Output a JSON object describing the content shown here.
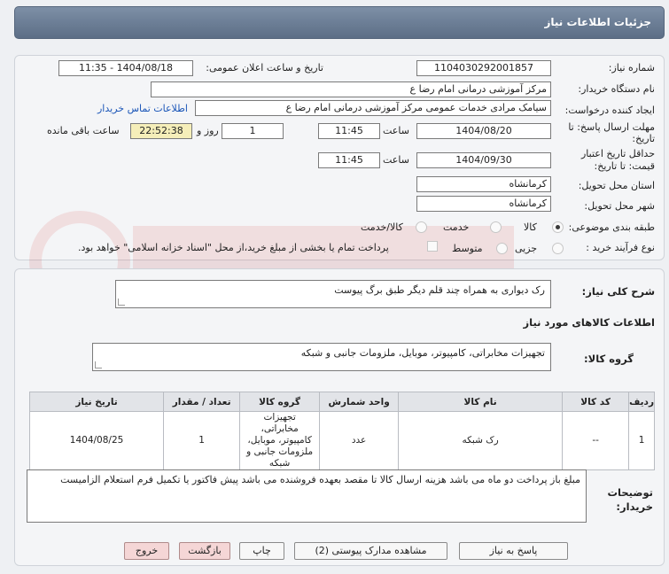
{
  "header": {
    "title": "جزئیات اطلاعات نیاز"
  },
  "form": {
    "need_number": {
      "label": "شماره نیاز:",
      "value": "1104030292001857"
    },
    "announce_datetime": {
      "label": "تاریخ و ساعت اعلان عمومی:",
      "value": "1404/08/18 - 11:35"
    },
    "buyer_org": {
      "label": "نام دستگاه خریدار:",
      "value": "مرکز آموزشی  درمانی امام رضا  ع"
    },
    "requester": {
      "label": "ایجاد کننده درخواست:",
      "value": "سیامک مرادی خدمات عمومی مرکز آموزشی  درمانی امام رضا  ع",
      "contact_link": "اطلاعات تماس خریدار"
    },
    "deadline": {
      "label_line1": "مهلت ارسال پاسخ: تا",
      "label_line2": "تاریخ:",
      "date": "1404/08/20",
      "time_label": "ساعت",
      "time": "11:45",
      "days": "1",
      "days_label": "روز و",
      "remaining": "22:52:38",
      "remaining_label": "ساعت باقی مانده"
    },
    "price_validity": {
      "label_line1": "حداقل تاریخ اعتبار",
      "label_line2": "قیمت: تا تاریخ:",
      "date": "1404/09/30",
      "time_label": "ساعت",
      "time": "11:45"
    },
    "province": {
      "label": "استان محل تحویل:",
      "value": "کرمانشاه"
    },
    "city": {
      "label": "شهر محل تحویل:",
      "value": "کرمانشاه"
    },
    "category": {
      "label": "طبقه بندی موضوعی:",
      "options": [
        "کالا",
        "خدمت",
        "کالا/خدمت"
      ],
      "selected": 0
    },
    "purchase_type": {
      "label": "نوع فرآیند خرید :",
      "options": [
        "جزیی",
        "متوسط"
      ],
      "selected": -1,
      "note": "پرداخت تمام یا بخشی از مبلغ خرید،از محل \"اسناد خزانه اسلامی\" خواهد بود."
    }
  },
  "description": {
    "label": "شرح کلی نیاز:",
    "value": "رک دیواری به همراه چند قلم دیگر طبق برگ پیوست"
  },
  "goods_info": {
    "heading": "اطلاعات کالاهای مورد نیاز",
    "group_label": "گروه کالا:",
    "group_value": "تجهیزات مخابراتی، کامپیوتر، موبایل، ملزومات جانبی و شبکه"
  },
  "items_table": {
    "columns": [
      "ردیف",
      "کد کالا",
      "نام کالا",
      "واحد شمارش",
      "گروه کالا",
      "تعداد / مقدار",
      "تاریخ نیاز"
    ],
    "rows": [
      [
        "1",
        "--",
        "رک شبکه",
        "عدد",
        "تجهیزات مخابراتی، کامپیوتر، موبایل، ملزومات جانبی و شبکه",
        "1",
        "1404/08/25"
      ]
    ]
  },
  "buyer_notes": {
    "label_line1": "توضیحات",
    "label_line2": "خریدار:",
    "value": "مبلغ باز پرداخت دو ماه می باشد هزینه ارسال کالا تا مقصد بعهده فروشنده می باشد پیش فاکتور یا تکمیل فرم استعلام الزامیست"
  },
  "buttons": {
    "reply": "پاسخ به نیاز",
    "attachments": "مشاهده مدارک پیوستی (2)",
    "print": "چاپ",
    "back": "بازگشت",
    "exit": "خروج"
  },
  "colors": {
    "title_bar": "#6b7d95",
    "timer_bg": "#f5eeb9",
    "link": "#1b56b8",
    "pink_button": "#f5d6d6"
  }
}
